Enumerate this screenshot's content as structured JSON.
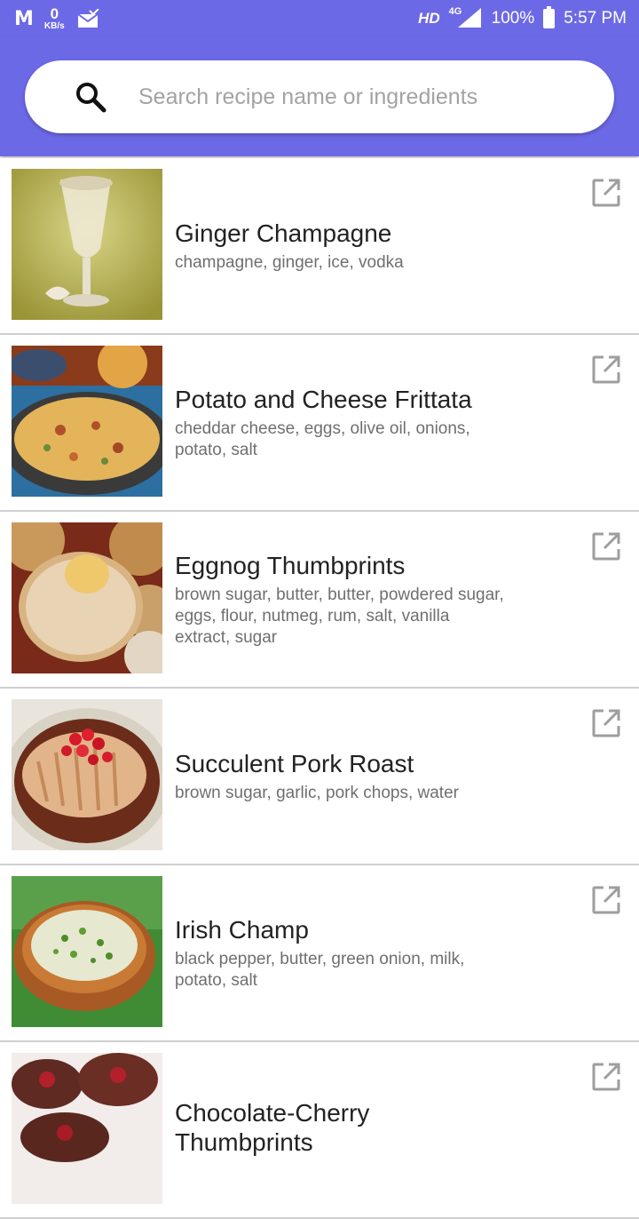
{
  "status_bar": {
    "carrier_logo": "M",
    "speed_value": "0",
    "speed_unit": "KB/s",
    "hd": "HD",
    "network": "4G",
    "battery": "100%",
    "time": "5:57 PM"
  },
  "search": {
    "placeholder": "Search recipe name or ingredients",
    "icon": "search-icon"
  },
  "recipes": [
    {
      "title": "Ginger Champagne",
      "ingredients": "champagne, ginger, ice, vodka"
    },
    {
      "title": "Potato and Cheese Frittata",
      "ingredients": "cheddar cheese, eggs, olive oil, onions, potato, salt"
    },
    {
      "title": "Eggnog Thumbprints",
      "ingredients": "brown sugar, butter, butter, powdered sugar, eggs, flour, nutmeg, rum, salt, vanilla extract, sugar"
    },
    {
      "title": "Succulent Pork Roast",
      "ingredients": "brown sugar, garlic, pork chops, water"
    },
    {
      "title": "Irish Champ",
      "ingredients": "black pepper, butter, green onion, milk, potato, salt"
    },
    {
      "title": "Chocolate-Cherry Thumbprints",
      "ingredients": ""
    }
  ],
  "colors": {
    "primary": "#6c69e6",
    "title_text": "#222222",
    "secondary_text": "#6f6f6f",
    "divider": "#cfcfcf",
    "icon_gray": "#9e9e9e"
  }
}
